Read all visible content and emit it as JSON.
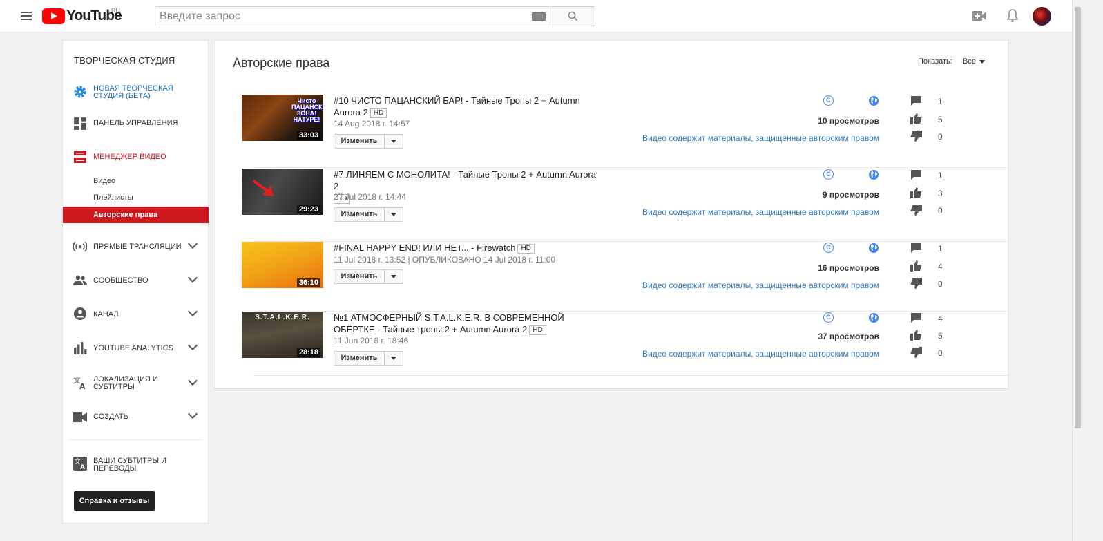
{
  "header": {
    "logo_text": "YouTube",
    "logo_region": "RU",
    "search_placeholder": "Введите запрос"
  },
  "sidebar": {
    "title": "ТВОРЧЕСКАЯ СТУДИЯ",
    "items": [
      {
        "label": "НОВАЯ ТВОРЧЕСКАЯ СТУДИЯ (БЕТА)",
        "icon": "gear-icon"
      },
      {
        "label": "ПАНЕЛЬ УПРАВЛЕНИЯ",
        "icon": "dashboard-icon"
      },
      {
        "label": "МЕНЕДЖЕР ВИДЕО",
        "icon": "video-manager-icon"
      },
      {
        "label": "ПРЯМЫЕ ТРАНСЛЯЦИИ",
        "icon": "live-icon"
      },
      {
        "label": "СООБЩЕСТВО",
        "icon": "community-icon"
      },
      {
        "label": "КАНАЛ",
        "icon": "channel-icon"
      },
      {
        "label": "YOUTUBE ANALYTICS",
        "icon": "analytics-icon"
      },
      {
        "label": "ЛОКАЛИЗАЦИЯ И СУБТИТРЫ",
        "icon": "translate-icon"
      },
      {
        "label": "СОЗДАТЬ",
        "icon": "create-icon"
      },
      {
        "label": "ВАШИ СУБТИТРЫ И ПЕРЕВОДЫ",
        "icon": "subtitles-icon"
      }
    ],
    "sub_items": [
      "Видео",
      "Плейлисты",
      "Авторские права"
    ],
    "help_button": "Справка и отзывы",
    "accent_color": "#cc181e"
  },
  "main": {
    "title": "Авторские права",
    "show_label": "Показать:",
    "show_value": "Все",
    "edit_label": "Изменить",
    "hd_badge": "HD",
    "claim_text": "Видео содержит материалы, защищенные авторским правом",
    "videos": [
      {
        "title": "#10 ЧИСТО ПАЦАНСКИЙ БАР! - Тайные Тропы 2 + Autumn Aurora 2",
        "date": "14 Aug 2018 г. 14:57",
        "duration": "33:03",
        "views": "10 просмотров",
        "comments": "1",
        "likes": "5",
        "dislikes": "0",
        "thumb_text": "Чисто ПАЦАНСКАЯ ЗОНА! НАТУРЕ!"
      },
      {
        "title": "#7 ЛИНЯЕМ С МОНОЛИТА! - Тайные Тропы 2 + Autumn Aurora 2",
        "date": "27 Jul 2018 г. 14:44",
        "duration": "29:23",
        "views": "9 просмотров",
        "comments": "1",
        "likes": "3",
        "dislikes": "0",
        "thumb_text": ""
      },
      {
        "title": "#FINAL HAPPY END! ИЛИ НЕТ... - Firewatch",
        "date": "11 Jul 2018 г. 13:52 | ОПУБЛИКОВАНО 14 Jul 2018 г. 11:00",
        "duration": "36:10",
        "views": "16 просмотров",
        "comments": "1",
        "likes": "4",
        "dislikes": "0",
        "thumb_text": ""
      },
      {
        "title": "№1 АТМОСФЕРНЫЙ S.T.A.L.K.E.R. В СОВРЕМЕННОЙ ОБЁРТКЕ - Тайные тропы 2 + Autumn Aurora 2",
        "date": "11 Jun 2018 г. 18:46",
        "duration": "28:18",
        "views": "37 просмотров",
        "comments": "4",
        "likes": "5",
        "dislikes": "0",
        "thumb_text": "S.T.A.L.K.E.R."
      }
    ]
  }
}
